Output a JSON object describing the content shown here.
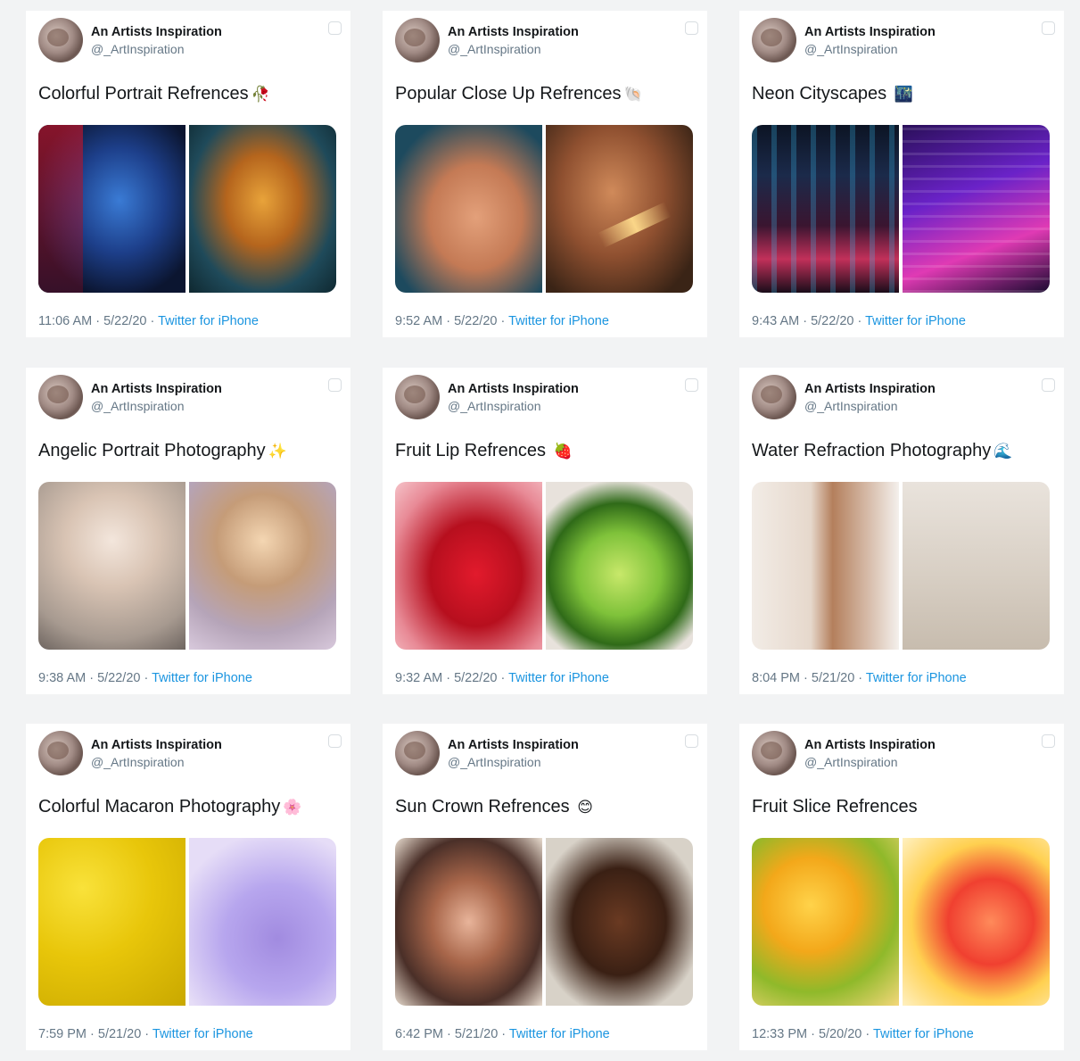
{
  "author": {
    "name": "An Artists Inspiration",
    "handle": "@_ArtInspiration"
  },
  "tweets": [
    {
      "text": "Colorful Portrait Refrences",
      "emoji": "🥀",
      "time": "11:06 AM · 5/22/20 · ",
      "source": "Twitter for iPhone",
      "photos": [
        "portrait-blue",
        "portrait-gold"
      ]
    },
    {
      "text": "Popular Close Up Refrences",
      "emoji": "🐚",
      "time": "9:52 AM · 5/22/20 · ",
      "source": "Twitter for iPhone",
      "photos": [
        "close-1",
        "close-2"
      ]
    },
    {
      "text": "Neon Cityscapes ",
      "emoji": "🌃",
      "time": "9:43 AM · 5/22/20 · ",
      "source": "Twitter for iPhone",
      "photos": [
        "neon-1",
        "neon-2"
      ]
    },
    {
      "text": "Angelic Portrait Photography",
      "emoji": "✨",
      "time": "9:38 AM · 5/22/20 · ",
      "source": "Twitter for iPhone",
      "photos": [
        "angel-1",
        "angel-2"
      ]
    },
    {
      "text": "Fruit Lip Refrences ",
      "emoji": "🍓",
      "time": "9:32 AM · 5/22/20 · ",
      "source": "Twitter for iPhone",
      "photos": [
        "berry",
        "lime"
      ]
    },
    {
      "text": "Water Refraction Photography",
      "emoji": "🌊",
      "time": "8:04 PM · 5/21/20 · ",
      "source": "Twitter for iPhone",
      "photos": [
        "water-1",
        "water-2"
      ]
    },
    {
      "text": "Colorful Macaron Photography",
      "emoji": "🌸",
      "time": "7:59 PM · 5/21/20 · ",
      "source": "Twitter for iPhone",
      "photos": [
        "macaron-y",
        "macaron-p"
      ]
    },
    {
      "text": "Sun Crown Refrences ",
      "emoji": "😊",
      "time": "6:42 PM · 5/21/20 · ",
      "source": "Twitter for iPhone",
      "photos": [
        "sun-1",
        "sun-2"
      ]
    },
    {
      "text": "Fruit Slice Refrences",
      "emoji": "",
      "time": "12:33 PM · 5/20/20 · ",
      "source": "Twitter for iPhone",
      "photos": [
        "fruit-1",
        "fruit-2"
      ]
    }
  ],
  "colors": {
    "background": "#f2f3f4",
    "card": "#ffffff",
    "link": "#1b95e0",
    "muted": "#657786",
    "text": "#14171a"
  },
  "icons": {
    "corner": "bookmark-corner-icon"
  }
}
